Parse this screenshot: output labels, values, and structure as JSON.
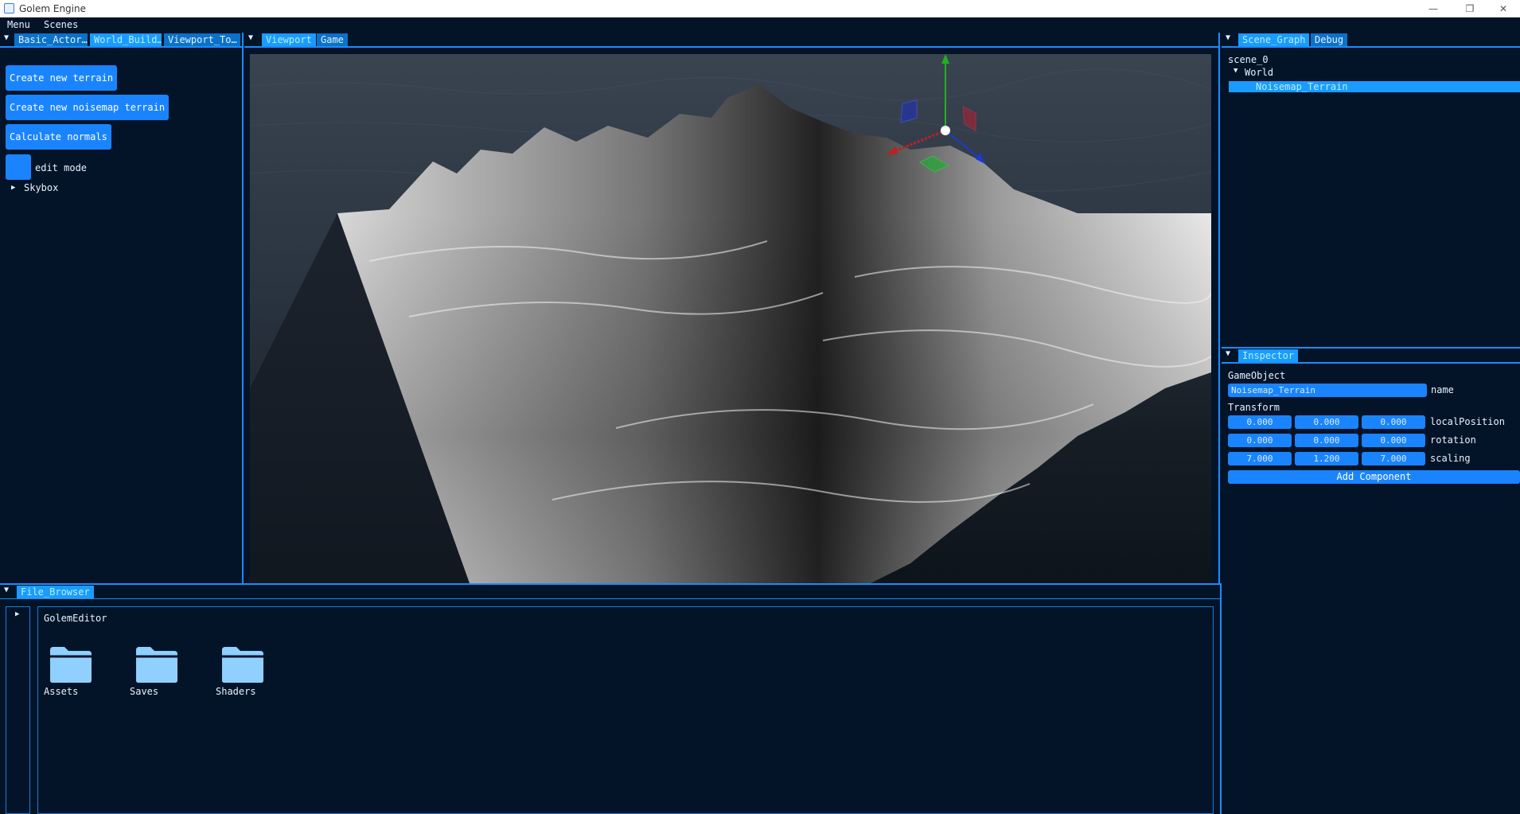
{
  "window": {
    "title": "Golem Engine",
    "controls": [
      "—",
      "❐",
      "✕"
    ]
  },
  "menubar": [
    "Menu",
    "Scenes"
  ],
  "left_panel": {
    "tabs": [
      "Basic_Actor…",
      "World_Build…",
      "Viewport_To…"
    ],
    "buttons": {
      "create_terrain": "Create new terrain",
      "create_noisemap": "Create new noisemap terrain",
      "calc_normals": "Calculate normals"
    },
    "edit_mode_label": "edit mode",
    "skybox_label": "Skybox"
  },
  "viewport": {
    "tabs": [
      "Viewport",
      "Game"
    ]
  },
  "scene_graph": {
    "tabs": [
      "Scene_Graph",
      "Debug"
    ],
    "root": "scene_0",
    "world": "World",
    "selected": "Noisemap_Terrain"
  },
  "inspector": {
    "tab": "Inspector",
    "section_gameobject": "GameObject",
    "name_value": "Noisemap_Terrain",
    "name_label": "name",
    "section_transform": "Transform",
    "rows": [
      {
        "label": "localPosition",
        "x": "0.000",
        "y": "0.000",
        "z": "0.000"
      },
      {
        "label": "rotation",
        "x": "0.000",
        "y": "0.000",
        "z": "0.000"
      },
      {
        "label": "scaling",
        "x": "7.000",
        "y": "1.200",
        "z": "7.000"
      }
    ],
    "add_component": "Add Component"
  },
  "file_browser": {
    "tab": "File_Browser",
    "current_folder": "GolemEditor",
    "folders": [
      "Assets",
      "Saves",
      "Shaders"
    ]
  },
  "colors": {
    "background": "#041428",
    "accent": "#1a84ff",
    "active_tab": "#1a9cff",
    "border": "#0f7fe0",
    "folder": "#8fd0ff"
  }
}
